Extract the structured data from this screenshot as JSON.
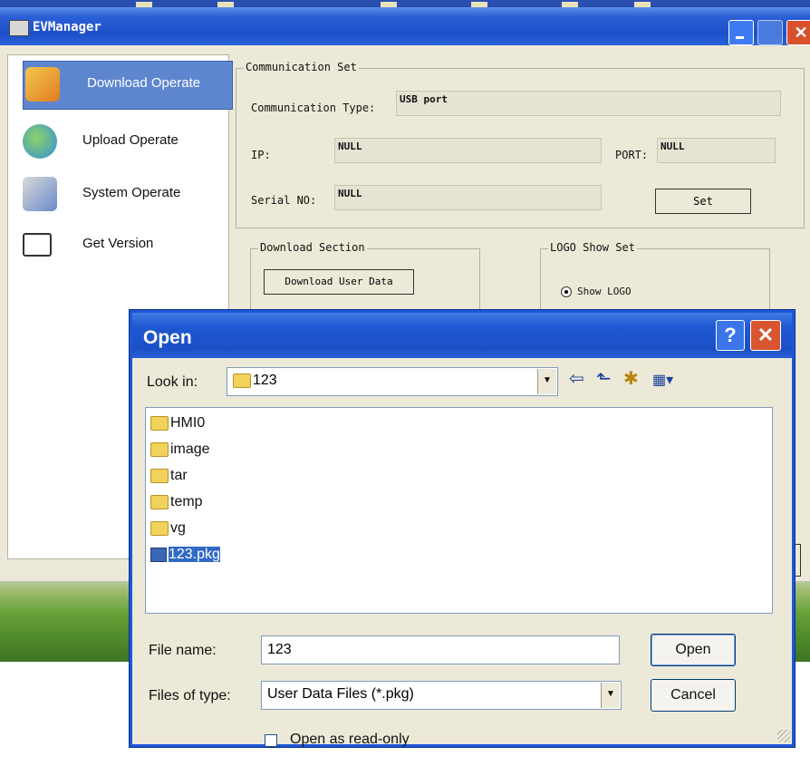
{
  "main_window": {
    "title": "EVManager",
    "close_glyph": "✕",
    "nav": [
      {
        "label": "Download Operate",
        "icon": "download-icon",
        "active": true
      },
      {
        "label": "Upload Operate",
        "icon": "upload-icon",
        "active": false
      },
      {
        "label": "System Operate",
        "icon": "tools-icon",
        "active": false
      },
      {
        "label": "Get Version",
        "icon": "version-icon",
        "active": false
      }
    ],
    "communication": {
      "group_title": "Communication Set",
      "type_label": "Communication Type:",
      "type_value": "USB port",
      "ip_label": "IP:",
      "ip_value": "NULL",
      "port_label": "PORT:",
      "port_value": "NULL",
      "serial_label": "Serial NO:",
      "serial_value": "NULL",
      "set_button": "Set"
    },
    "download_section": {
      "group_title": "Download Section",
      "button": "Download User Data"
    },
    "logo_show": {
      "group_title": "LOGO Show Set",
      "option": "Show LOGO"
    }
  },
  "dialog": {
    "title": "Open",
    "help_glyph": "?",
    "close_glyph": "✕",
    "look_in_label": "Look in:",
    "look_in_value": "123",
    "toolbar_icons": [
      "back-icon",
      "up-folder-icon",
      "new-folder-icon",
      "view-menu-icon"
    ],
    "toolbar_glyphs": [
      "⇦",
      "⬑",
      "✱",
      "▦▾"
    ],
    "files": [
      {
        "name": "HMI0",
        "type": "folder",
        "selected": false
      },
      {
        "name": "image",
        "type": "folder",
        "selected": false
      },
      {
        "name": "tar",
        "type": "folder",
        "selected": false
      },
      {
        "name": "temp",
        "type": "folder",
        "selected": false
      },
      {
        "name": "vg",
        "type": "folder",
        "selected": false
      },
      {
        "name": "123.pkg",
        "type": "pkg",
        "selected": true
      }
    ],
    "file_name_label": "File name:",
    "file_name_value": "123",
    "file_type_label": "Files of type:",
    "file_type_value": "User Data Files (*.pkg)",
    "open_button": "Open",
    "cancel_button": "Cancel",
    "readonly_label": "Open as read-only",
    "readonly_checked": false
  }
}
